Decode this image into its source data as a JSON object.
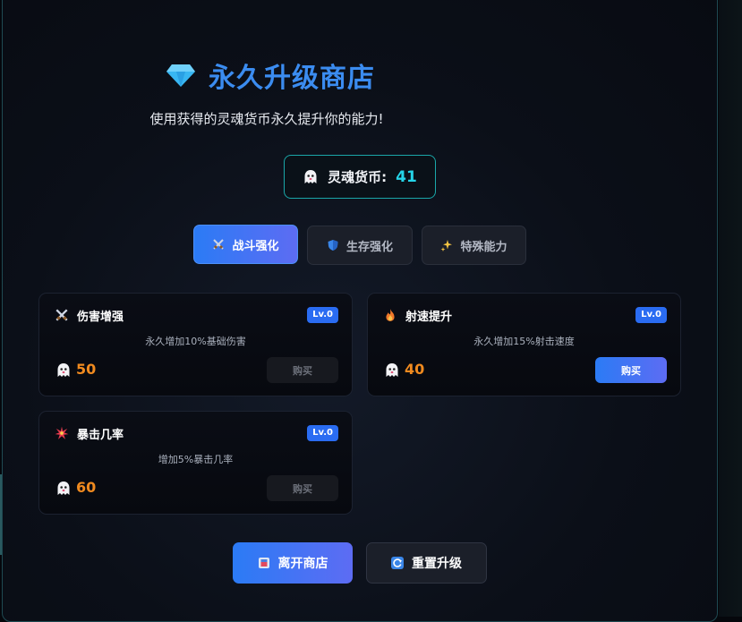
{
  "shop": {
    "title": "永久升级商店",
    "subtitle": "使用获得的灵魂货币永久提升你的能力!",
    "currency_label": "灵魂货币:",
    "currency_value": "41"
  },
  "tabs": [
    {
      "label": "战斗强化",
      "icon": "crossed-swords-icon",
      "active": true
    },
    {
      "label": "生存强化",
      "icon": "shield-icon",
      "active": false
    },
    {
      "label": "特殊能力",
      "icon": "sparkles-icon",
      "active": false
    }
  ],
  "upgrades": [
    {
      "name": "伤害增强",
      "icon": "crossed-swords-icon",
      "level": "Lv.0",
      "description": "永久增加10%基础伤害",
      "price": "50",
      "buy_label": "购买",
      "affordable": false
    },
    {
      "name": "射速提升",
      "icon": "fire-icon",
      "level": "Lv.0",
      "description": "永久增加15%射击速度",
      "price": "40",
      "buy_label": "购买",
      "affordable": true
    },
    {
      "name": "暴击几率",
      "icon": "burst-icon",
      "level": "Lv.0",
      "description": "增加5%暴击几率",
      "price": "60",
      "buy_label": "购买",
      "affordable": false
    }
  ],
  "actions": {
    "leave_label": "离开商店",
    "reset_label": "重置升级"
  },
  "colors": {
    "accent": "#3b8cf0",
    "currency": "#25d4e8",
    "price": "#f08a1f",
    "level_badge": "#2a6cf2"
  }
}
